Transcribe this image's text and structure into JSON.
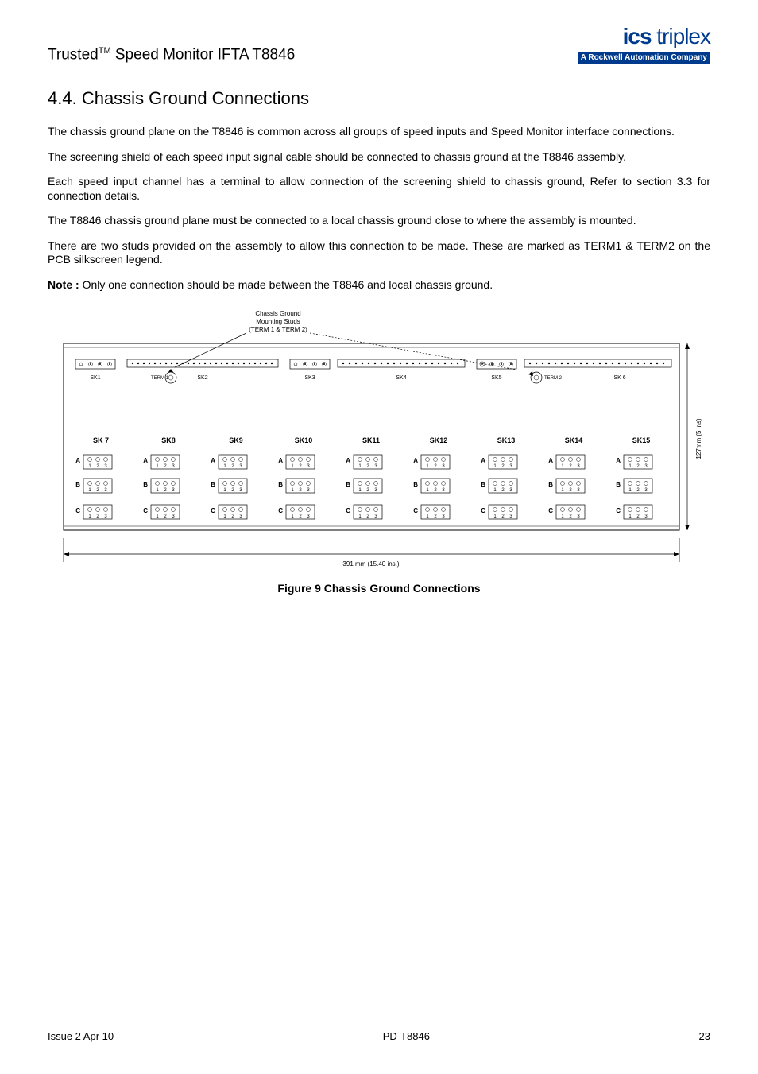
{
  "header": {
    "title_prefix": "Trusted",
    "title_tm": "TM",
    "title_suffix": " Speed Monitor IFTA T8846",
    "logo_main_bold": "ics",
    "logo_main_light": " triplex",
    "logo_sub_prefix": "A ",
    "logo_sub_bold": "Rockwell Automation",
    "logo_sub_suffix": " Company"
  },
  "section": {
    "number": "4.4.",
    "title": "Chassis Ground Connections"
  },
  "paragraphs": {
    "p1": "The chassis ground plane on the T8846 is common across all groups of speed inputs and Speed Monitor interface connections.",
    "p2": "The screening shield of each speed input signal cable should be connected to chassis ground at the T8846 assembly.",
    "p3": "Each speed input channel has a terminal to allow connection of the screening shield to chassis ground, Refer to section 3.3 for connection details.",
    "p4": "The T8846 chassis ground plane must be connected to a local chassis ground close to where the assembly is mounted.",
    "p5": "There are two studs provided on the assembly to allow this connection to be made. These are marked as TERM1 & TERM2 on the PCB silkscreen legend.",
    "note_label": "Note : ",
    "note_text": "Only one connection should be made between the T8846 and local chassis ground."
  },
  "figure": {
    "label_line1": "Chassis Ground",
    "label_line2": "Mounting Studs",
    "label_line3": "(TERM 1 & TERM 2)",
    "top_labels": {
      "sk1": "SK1",
      "term1": "TERM 1",
      "sk2": "SK2",
      "sk3": "SK3",
      "sk4": "SK4",
      "sk5": "SK5",
      "term2": "TERM 2",
      "sk6": "SK 6"
    },
    "sk_labels": [
      "SK 7",
      "SK8",
      "SK9",
      "SK10",
      "SK11",
      "SK12",
      "SK13",
      "SK14",
      "SK15"
    ],
    "row_labels": [
      "A",
      "B",
      "C"
    ],
    "pin_labels": "1 2 3",
    "width_label": "391 mm (15.40 ins.)",
    "height_label": "127mm (5 ins)",
    "caption": "Figure 9 Chassis Ground Connections"
  },
  "footer": {
    "left": "Issue 2 Apr 10",
    "center": "PD-T8846",
    "right": "23"
  }
}
